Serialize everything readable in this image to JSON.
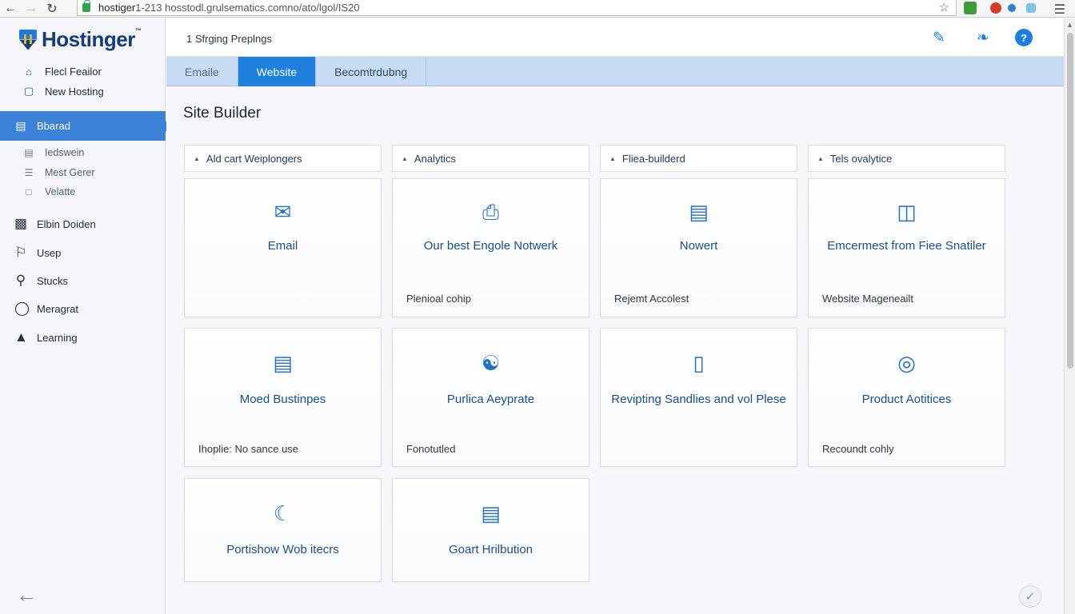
{
  "browser": {
    "url_host": "hostiger",
    "url_rest": " 1-213 hosstodl.grulsematics.comno/ato/lgol/IS20",
    "back_icon": "arrow-left-icon",
    "forward_icon": "arrow-right-icon",
    "reload_icon": "reload-icon",
    "star_icon": "star-icon"
  },
  "sidebar": {
    "logo_text": "Hostinger",
    "logo_mark": "™",
    "top_items": [
      {
        "label": "Flecl Feailor",
        "icon": "home-icon"
      },
      {
        "label": "New Hosting",
        "icon": "window-icon"
      }
    ],
    "active_item": {
      "label": "Bbarad",
      "icon": "dashboard-icon"
    },
    "sub_items": [
      {
        "label": "Iedswein",
        "icon": "server-icon"
      },
      {
        "label": "Mest Gerer",
        "icon": "list-icon"
      },
      {
        "label": "Velatte",
        "icon": "folder-icon"
      }
    ],
    "main_items": [
      {
        "label": "Elbin Doiden",
        "icon": "storage-icon"
      },
      {
        "label": "Usep",
        "icon": "flag-icon"
      },
      {
        "label": "Stucks",
        "icon": "search-icon"
      },
      {
        "label": "Meragrat",
        "icon": "shield-icon"
      },
      {
        "label": "Learning",
        "icon": "lock-icon"
      }
    ]
  },
  "topbar": {
    "breadcrumb": "1 Sfrging Preplngs",
    "icons": [
      "edit-icon",
      "twitter-icon",
      "help-icon"
    ]
  },
  "tabs": [
    {
      "label": "Emaile",
      "active": false
    },
    {
      "label": "Website",
      "active": true
    },
    {
      "label": "Becomtrdubng",
      "active": false
    }
  ],
  "main": {
    "section_title": "Site Builder",
    "filters": [
      "Ald cart Weiplongers",
      "Analytics",
      "Fliea-builderd",
      "Tels ovalytice"
    ],
    "cards": [
      {
        "title": "Email",
        "footer": "",
        "icon": "mail-icon"
      },
      {
        "title": "Our best Engole Notwerk",
        "footer": "Plenioal cohip",
        "icon": "printer-icon"
      },
      {
        "title": "Nowert",
        "footer": "Rejemt Accolest",
        "icon": "document-icon"
      },
      {
        "title": "Emcermest from Fiee Snatiler",
        "footer": "Website Mageneailt",
        "icon": "image-icon"
      },
      {
        "title": "Moed Bustinpes",
        "footer": "Ihoplie: No sance use",
        "icon": "card-icon"
      },
      {
        "title": "Purlica Aeyprate",
        "footer": "Fonotutled",
        "icon": "network-icon"
      },
      {
        "title": "Revipting Sandlies and vol Plese",
        "footer": "",
        "icon": "phone-icon"
      },
      {
        "title": "Product Aotitices",
        "footer": "Recoundt cohly",
        "icon": "target-icon"
      },
      {
        "title": "Portishow Wob itecrs",
        "footer": "",
        "icon": "globe-icon"
      },
      {
        "title": "Goart Hrilbution",
        "footer": "",
        "icon": "list-doc-icon"
      }
    ]
  },
  "colors": {
    "accent": "#1f7fdc",
    "sidebar_active": "#3c82d8",
    "tabbar": "#c7dcf2",
    "brand_dark": "#143d7a"
  }
}
